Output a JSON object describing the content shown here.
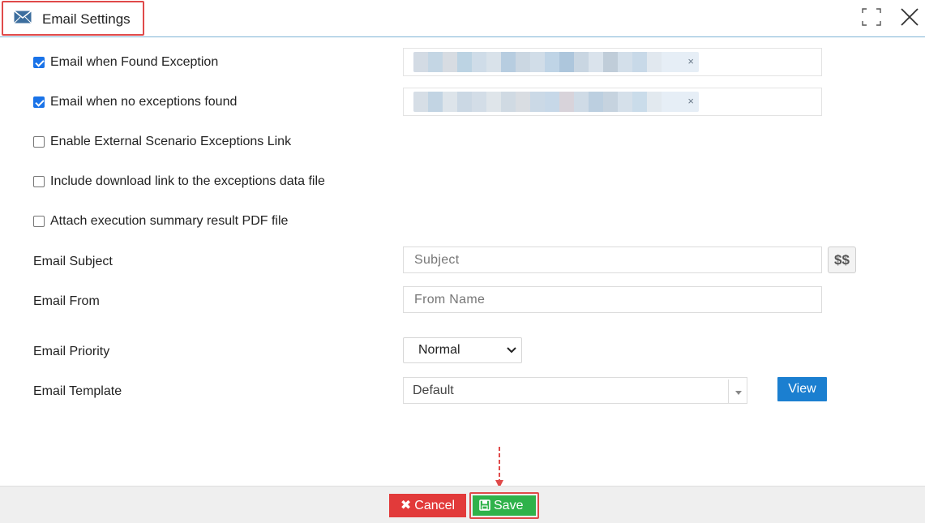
{
  "header": {
    "title": "Email Settings",
    "title_icon": "envelope-icon",
    "expand_icon": "expand-icon",
    "close_icon": "close-icon"
  },
  "options": [
    {
      "label": "Email when Found Exception",
      "checked": true
    },
    {
      "label": "Email when no exceptions found",
      "checked": true
    },
    {
      "label": "Enable External Scenario Exceptions Link",
      "checked": false
    },
    {
      "label": "Include download link to the exceptions data file",
      "checked": false
    },
    {
      "label": "Attach execution summary result PDF file",
      "checked": false
    }
  ],
  "recipients": {
    "remove_symbol": "×"
  },
  "fields": {
    "subject_label": "Email Subject",
    "subject_placeholder": "Subject",
    "subject_value": "",
    "variables_button": "$$",
    "from_label": "Email From",
    "from_placeholder": "From Name",
    "from_value": "",
    "priority_label": "Email Priority",
    "priority_value": "Normal",
    "template_label": "Email Template",
    "template_value": "Default",
    "view_button": "View"
  },
  "footer": {
    "cancel_label": "Cancel",
    "cancel_symbol": "✖",
    "save_label": "Save"
  },
  "colors": {
    "accent": "#1b7fd0",
    "cancel": "#e23a3a",
    "save": "#2fb24a",
    "highlight": "#e04a4a"
  }
}
